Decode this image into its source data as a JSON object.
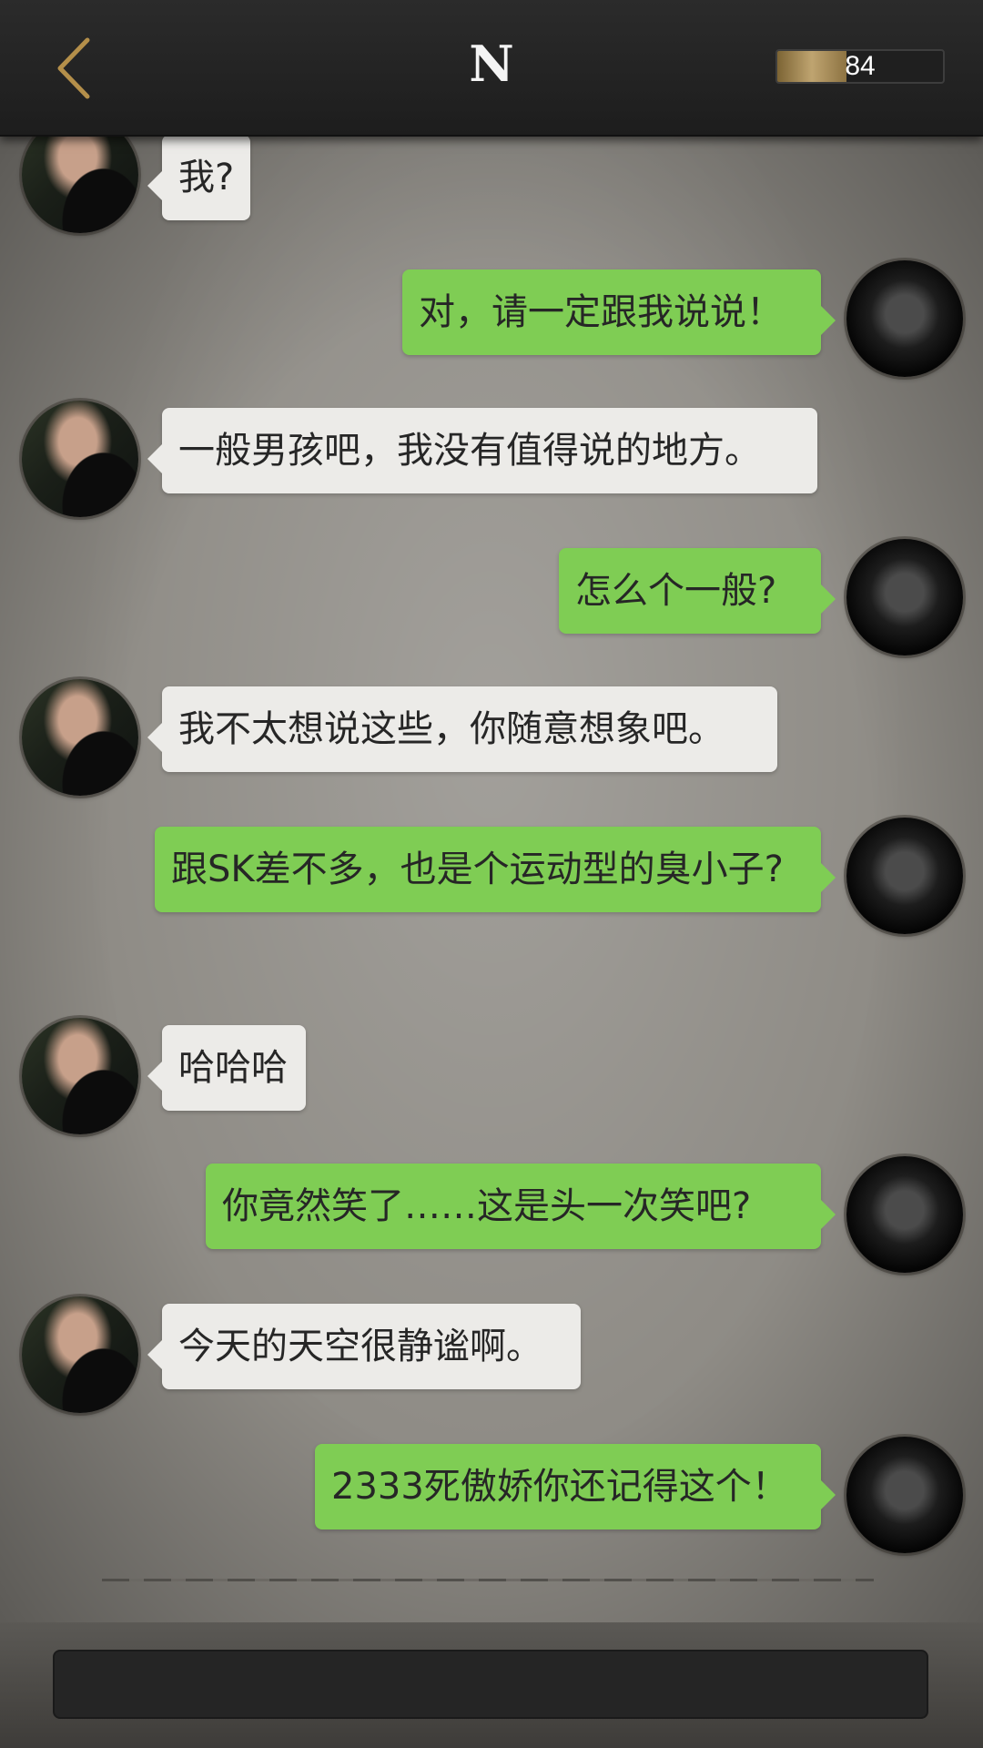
{
  "header": {
    "title": "N",
    "energy_value": "84",
    "energy_fraction": 0.42
  },
  "colors": {
    "npc_bubble": "#ecebe8",
    "player_bubble": "#7fcd54",
    "back_arrow": "#b48f4a"
  },
  "messages": [
    {
      "from": "npc",
      "text": "我?"
    },
    {
      "from": "me",
      "text": "对，请一定跟我说说！"
    },
    {
      "from": "npc",
      "text": "一般男孩吧，我没有值得说的地方。"
    },
    {
      "from": "me",
      "text": "怎么个一般?"
    },
    {
      "from": "npc",
      "text": "我不太想说这些，你随意想象吧。"
    },
    {
      "from": "me",
      "text": "跟SK差不多，也是个运动型的臭小子?"
    },
    {
      "from": "npc",
      "text": "哈哈哈"
    },
    {
      "from": "me",
      "text": "你竟然笑了……这是头一次笑吧?"
    },
    {
      "from": "npc",
      "text": "今天的天空很静谧啊。"
    },
    {
      "from": "me",
      "text": "2333死傲娇你还记得这个！"
    }
  ],
  "icons": {
    "back": "chevron-left-icon"
  }
}
